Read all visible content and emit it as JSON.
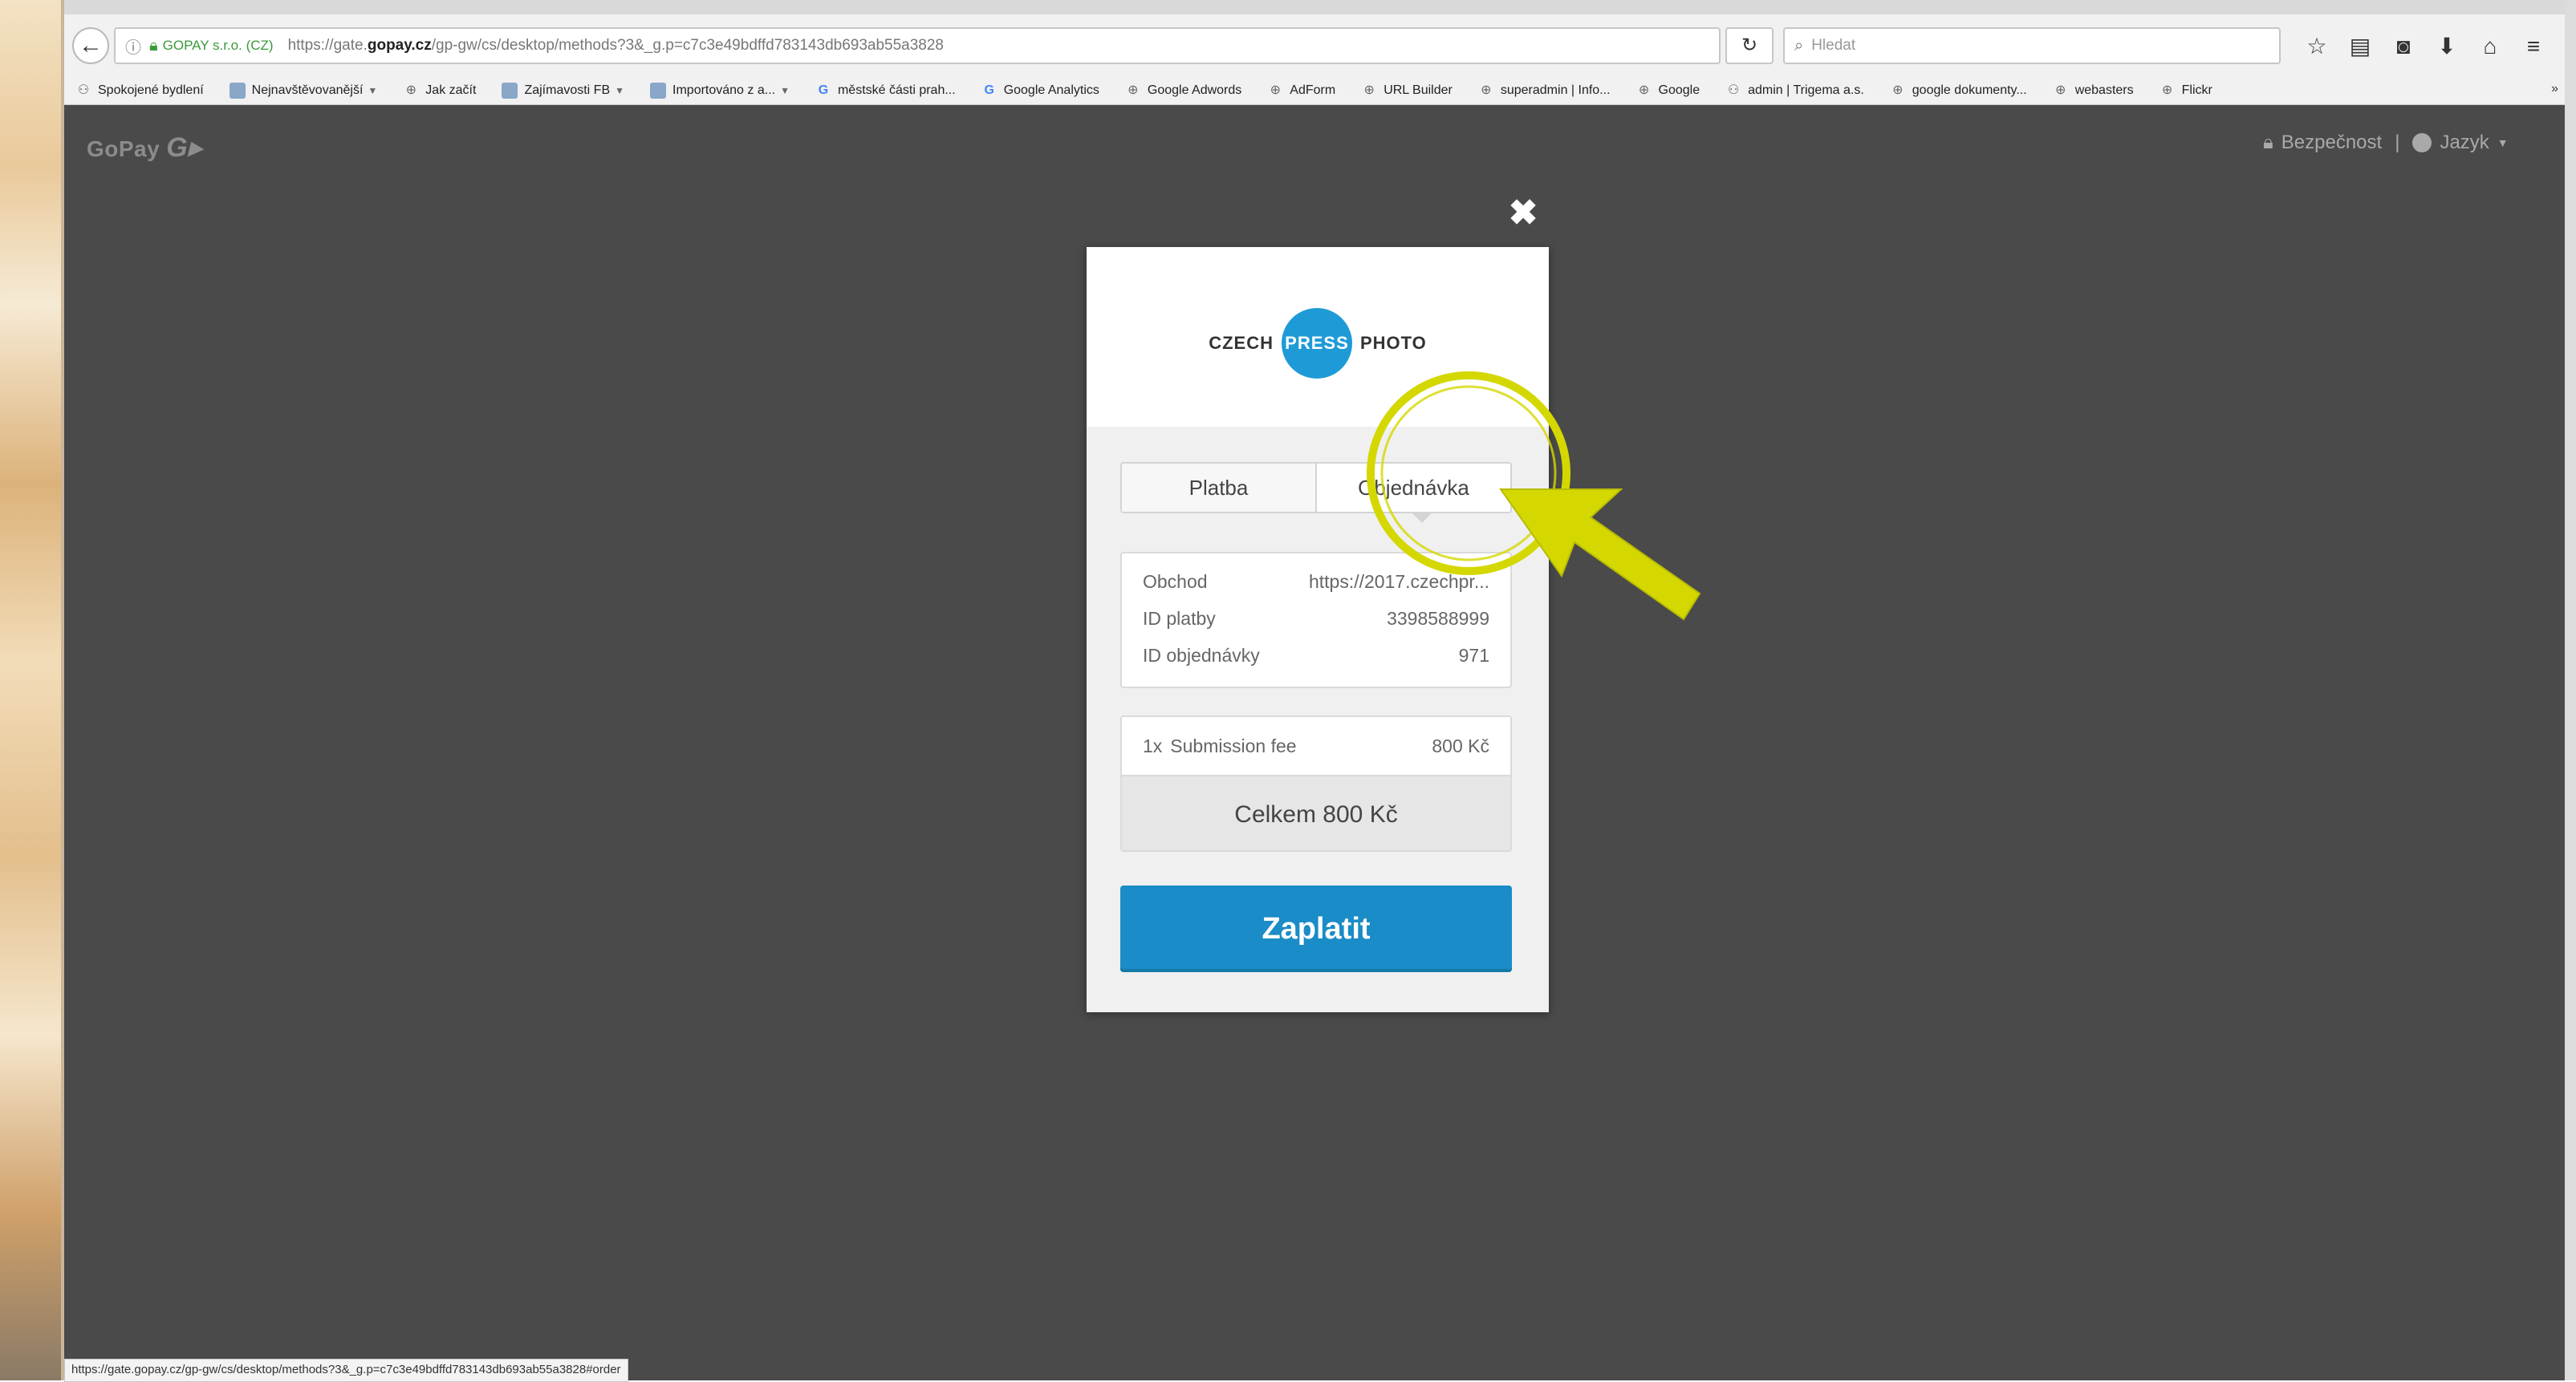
{
  "browser": {
    "back_icon": "back-arrow-icon",
    "identity": "GOPAY s.r.o. (CZ)",
    "url_prefix": "https://gate.",
    "url_domain": "gopay.cz",
    "url_path": "/gp-gw/cs/desktop/methods?3&_g.p=c7c3e49bdffd783143db693ab55a3828",
    "search_placeholder": "Hledat",
    "toolbar_icons": [
      "star-icon",
      "reading-list-icon",
      "pocket-icon",
      "download-icon",
      "home-icon",
      "menu-icon"
    ]
  },
  "bookmarks": [
    {
      "label": "Spokojené bydlení",
      "icon": "people-icon"
    },
    {
      "label": "Nejnavštěvovanější",
      "icon": "folder-icon",
      "dropdown": true
    },
    {
      "label": "Jak začít",
      "icon": "globe-icon"
    },
    {
      "label": "Zajímavosti FB",
      "icon": "folder-icon",
      "dropdown": true
    },
    {
      "label": "Importováno z a...",
      "icon": "folder-icon",
      "dropdown": true
    },
    {
      "label": "městské části prah...",
      "icon": "google-icon"
    },
    {
      "label": "Google Analytics",
      "icon": "google-icon"
    },
    {
      "label": "Google Adwords",
      "icon": "globe-icon"
    },
    {
      "label": "AdForm",
      "icon": "globe-icon"
    },
    {
      "label": "URL Builder",
      "icon": "globe-icon"
    },
    {
      "label": "superadmin | Info...",
      "icon": "globe-icon"
    },
    {
      "label": "Google",
      "icon": "globe-icon"
    },
    {
      "label": "admin | Trigema a.s.",
      "icon": "people-icon"
    },
    {
      "label": "google dokumenty...",
      "icon": "globe-icon"
    },
    {
      "label": "webasters",
      "icon": "globe-icon"
    },
    {
      "label": "Flickr",
      "icon": "globe-icon"
    }
  ],
  "bookmarks_more": "»",
  "page": {
    "brand": "GoPay",
    "security": "Bezpečnost",
    "separator": "|",
    "language": "Jazyk",
    "close": "✖"
  },
  "merchant": {
    "logo_left": "CZECH",
    "logo_circle": "PRESS",
    "logo_right": "PHOTO"
  },
  "tabs": [
    {
      "label": "Platba",
      "active": false
    },
    {
      "label": "Objednávka",
      "active": true
    }
  ],
  "info": [
    {
      "label": "Obchod",
      "value": "https://2017.czechpr..."
    },
    {
      "label": "ID platby",
      "value": "3398588999"
    },
    {
      "label": "ID objednávky",
      "value": "971"
    }
  ],
  "order": {
    "qty": "1x",
    "item": "Submission fee",
    "price": "800 Kč",
    "total": "Celkem 800 Kč"
  },
  "pay_button": "Zaplatit",
  "status_url": "https://gate.gopay.cz/gp-gw/cs/desktop/methods?3&_g.p=c7c3e49bdffd783143db693ab55a3828#order",
  "annotation_color": "#d4d800"
}
